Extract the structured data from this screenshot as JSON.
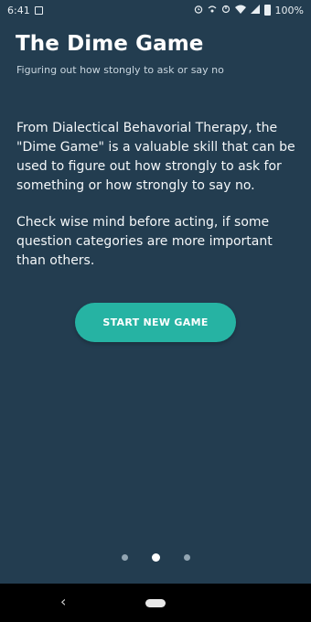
{
  "status_bar": {
    "time": "6:41",
    "battery": "100%",
    "icons": [
      "screenshot-icon",
      "alarm-icon",
      "wifi-calling-icon",
      "sync-icon",
      "wifi-icon",
      "signal-icon",
      "battery-icon"
    ]
  },
  "header": {
    "title": "The Dime Game",
    "subtitle": "Figuring out how stongly to ask or say no"
  },
  "content": {
    "paragraph1": "From Dialectical Behavorial Therapy, the \"Dime Game\" is a valuable skill that can be used to figure out how strongly to ask for something or how strongly to say no.",
    "paragraph2": "Check wise mind before acting, if some question categories are more important than others."
  },
  "actions": {
    "start_label": "START NEW GAME"
  },
  "pager": {
    "total": 3,
    "active_index": 1
  },
  "nav": {
    "back_glyph": "‹"
  },
  "colors": {
    "background": "#233d50",
    "accent": "#26b3a3",
    "text": "#ffffff"
  }
}
